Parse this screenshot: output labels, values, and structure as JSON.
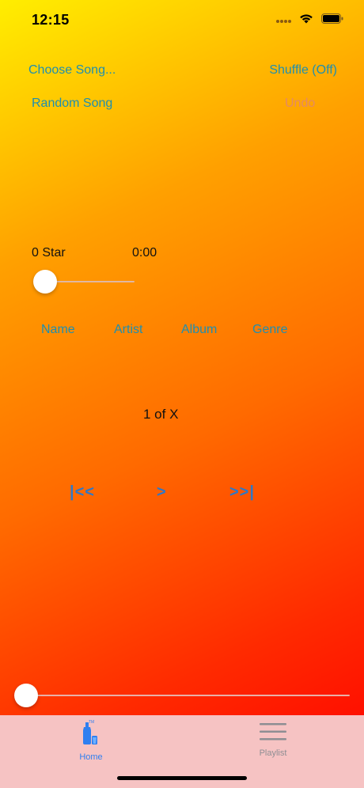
{
  "status_bar": {
    "time": "12:15"
  },
  "controls": {
    "choose_song": "Choose Song...",
    "shuffle": "Shuffle (Off)",
    "random_song": "Random Song",
    "undo": "Undo"
  },
  "now_playing": {
    "rating": "0 Star",
    "time": "0:00",
    "rating_slider_value": 0,
    "position_slider_value": 0
  },
  "info_buttons": [
    "Name",
    "Artist",
    "Album",
    "Genre"
  ],
  "counter": "1 of X",
  "transport": {
    "previous": "|<<",
    "play": ">",
    "next": ">>|"
  },
  "tabbar": {
    "tabs": [
      {
        "label": "Home",
        "icon": "bottle-icon",
        "selected": true
      },
      {
        "label": "Playlist",
        "icon": "list-icon",
        "selected": false
      }
    ]
  },
  "colors": {
    "link": "#1e8fb0",
    "transport": "#2e78c8",
    "tab_selected": "#2f7ff0",
    "tab_unselected": "#8e8e93",
    "tabbar_bg": "#f6c3c3"
  }
}
